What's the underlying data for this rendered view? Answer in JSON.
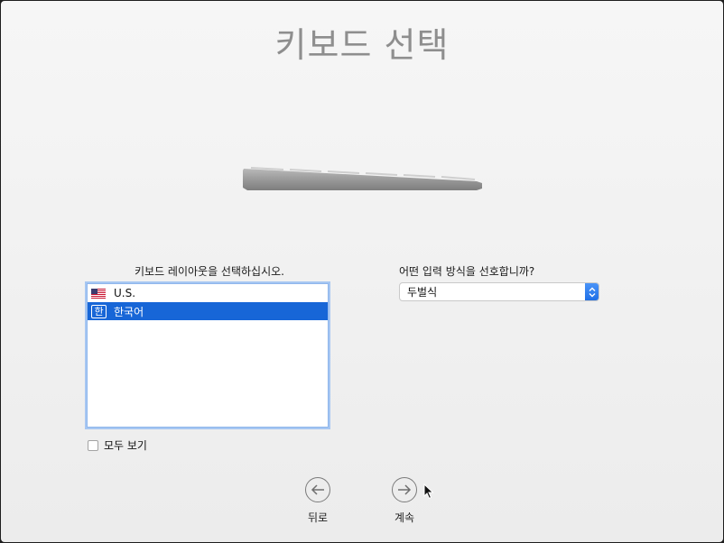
{
  "title": "키보드 선택",
  "layout_section": {
    "label": "키보드 레이아웃을 선택하십시오.",
    "items": [
      {
        "label": "U.S.",
        "icon": "us-flag-icon",
        "selected": false
      },
      {
        "label": "한국어",
        "icon": "hangul-icon",
        "icon_text": "한",
        "selected": true
      }
    ],
    "show_all_label": "모두 보기"
  },
  "input_section": {
    "label": "어떤 입력 방식을 선호합니까?",
    "selected_value": "두벌식"
  },
  "navigation": {
    "back_label": "뒤로",
    "continue_label": "계속"
  },
  "colors": {
    "selection": "#1766d7",
    "title": "#8e8e8e",
    "list_focus_ring": "#a7c7f2"
  }
}
